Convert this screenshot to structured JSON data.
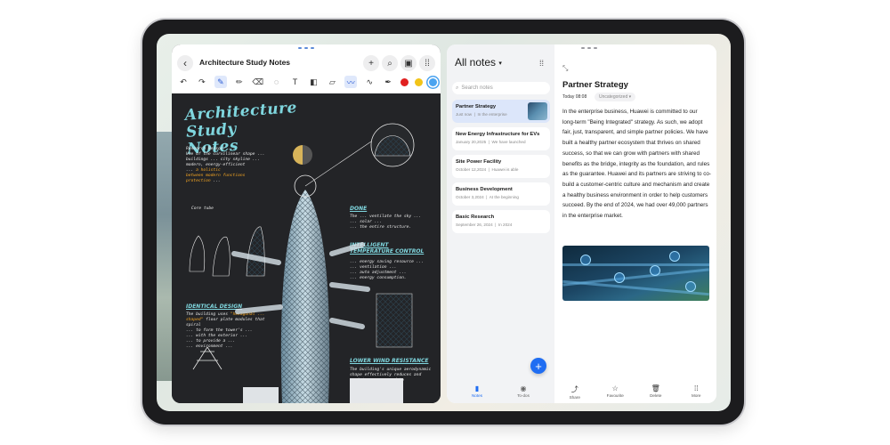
{
  "left_window": {
    "title": "Architecture Study Notes",
    "header_icons": [
      "plus-icon",
      "search-icon",
      "panel-icon",
      "more-icon"
    ],
    "toolbar_tools": [
      "undo-icon",
      "redo-icon",
      "pen-icon",
      "pencil-icon",
      "eraser-icon",
      "lasso-icon",
      "text-icon",
      "shape-icon",
      "ruler-icon",
      "highlighter-icon",
      "brush-icon",
      "marker-icon"
    ],
    "colors": [
      "#e02020",
      "#f2c418",
      "#4aa3f0"
    ],
    "canvas": {
      "heading": "Architecture Study Notes",
      "labels": {
        "done": "DONE",
        "intelligent": "INTELLIGENT TEMPERATURE CONTROL",
        "spiral": "IDENTICAL DESIGN",
        "wind": "LOWER WIND RESISTANCE",
        "core_tube": "Core tube"
      }
    }
  },
  "right_window": {
    "list_title": "All notes",
    "search_placeholder": "Search notes",
    "notes": [
      {
        "title": "Partner Strategy",
        "date": "Just now",
        "meta": "In the enterprise"
      },
      {
        "title": "New Energy Infrastructure for EVs",
        "date": "January 20,2025",
        "meta": "We have launched"
      },
      {
        "title": "Site Power Facility",
        "date": "October 12,2024",
        "meta": "Huawei is able"
      },
      {
        "title": "Business Development",
        "date": "October 3,2024",
        "meta": "At the beginning"
      },
      {
        "title": "Basic Research",
        "date": "September 26, 2024",
        "meta": "In 2024"
      }
    ],
    "bottom_tabs": [
      "Notes",
      "To-dos"
    ],
    "detail": {
      "title": "Partner Strategy",
      "date": "Today 08:08",
      "category": "Uncategorized",
      "body": "In the enterprise business, Huawei is committed to our long-term \"Being Integrated\" strategy. As such, we adopt fair, just, transparent, and simple partner policies. We have built a healthy partner ecosystem that thrives on shared success, so that we can grow with partners with shared benefits as the bridge, integrity as the foundation, and rules as the guarantee. Huawei and its partners are striving to co-build a customer-centric culture and mechanism and create a healthy business environment in order to help customers succeed. By the end of 2024, we had over 49,000 partners in the enterprise market.",
      "actions": [
        "Share",
        "Favourite",
        "Delete",
        "More"
      ]
    }
  }
}
